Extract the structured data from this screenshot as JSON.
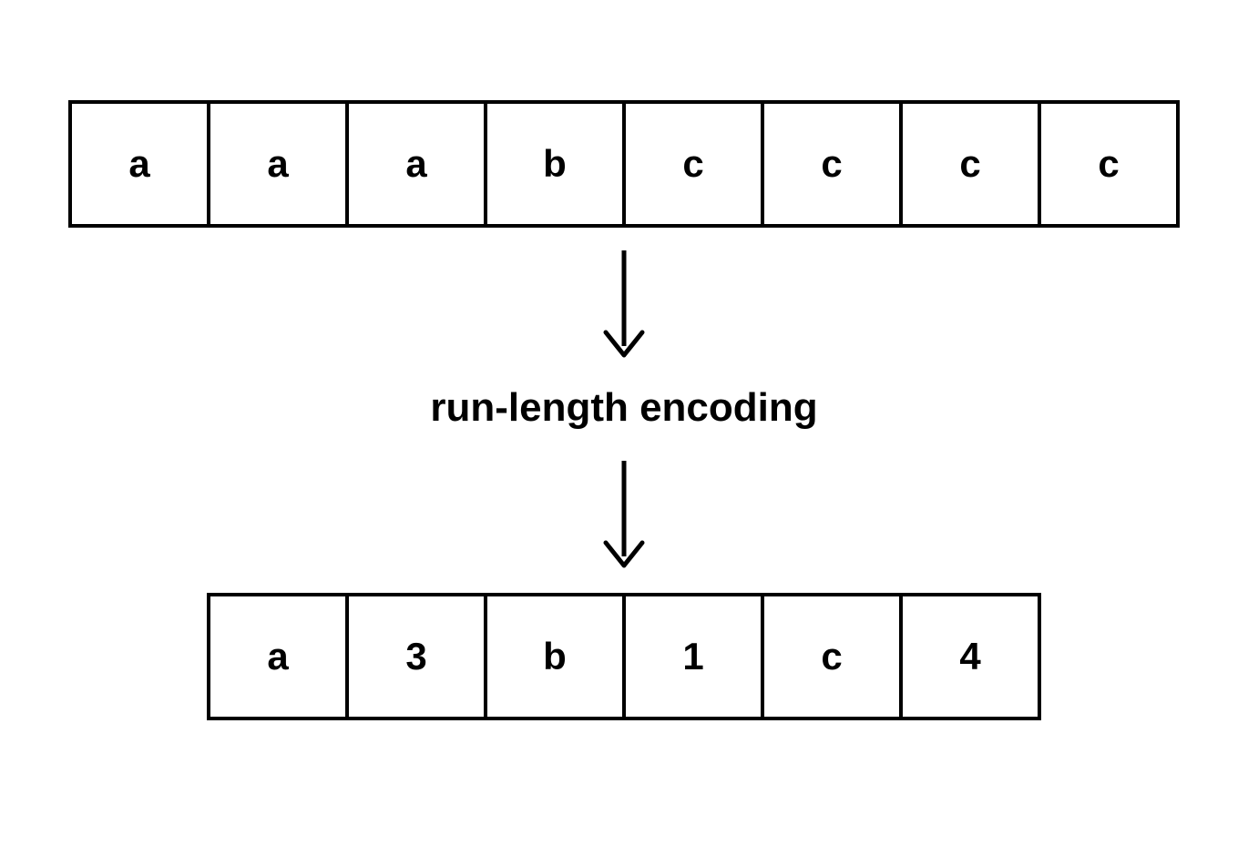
{
  "input_cells": [
    "a",
    "a",
    "a",
    "b",
    "c",
    "c",
    "c",
    "c"
  ],
  "label": "run-length encoding",
  "output_cells": [
    "a",
    "3",
    "b",
    "1",
    "c",
    "4"
  ]
}
